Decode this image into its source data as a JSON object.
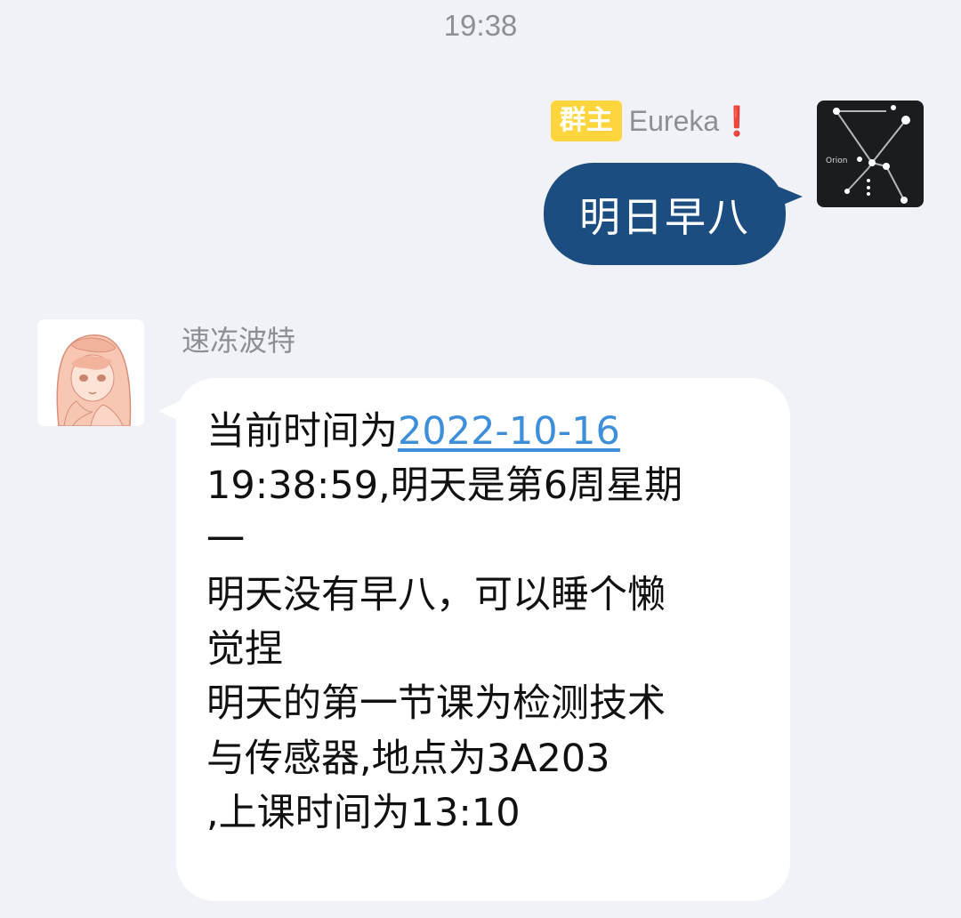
{
  "timestamp": "19:38",
  "outgoing": {
    "badge": "群主",
    "sender": "Eureka❗",
    "avatar_label": "Orion",
    "text": "明日早八"
  },
  "incoming": {
    "sender": "速冻波特",
    "lines": {
      "l1_prefix": "当前时间为",
      "l1_link": "2022-10-16",
      "l2": "19:38:59,明天是第6周星期",
      "l3": "一",
      "l4": "明天没有早八，可以睡个懒",
      "l5": "觉捏",
      "l6": "明天的第一节课为检测技术",
      "l7": "与传感器,地点为3A203",
      "l8": ",上课时间为13:10"
    }
  },
  "colors": {
    "background": "#f1f2f7",
    "outgoing_bubble": "#1c4d80",
    "owner_badge": "#ffd53d",
    "link": "#3e8fd9"
  }
}
